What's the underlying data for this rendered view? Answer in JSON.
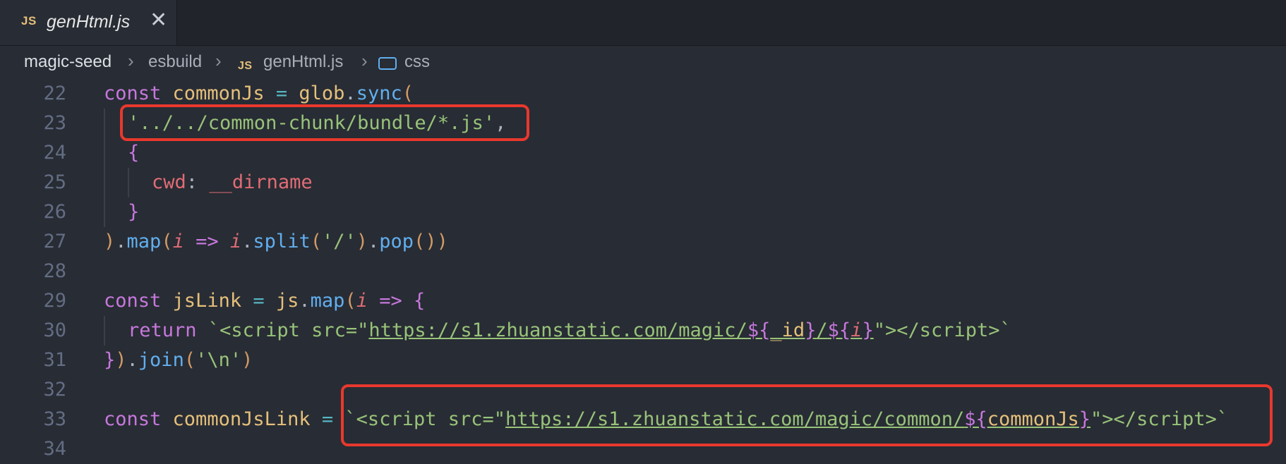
{
  "tab": {
    "badge": "JS",
    "title": "genHtml.js",
    "close": "✕"
  },
  "breadcrumb": {
    "items": [
      {
        "label": "magic-seed"
      },
      {
        "label": "esbuild"
      },
      {
        "label": "genHtml.js",
        "badge": "JS"
      },
      {
        "label": "css",
        "icon": "symbol-variable-icon"
      }
    ],
    "separator": "›"
  },
  "editor": {
    "line_numbers": [
      "22",
      "23",
      "24",
      "25",
      "26",
      "27",
      "28",
      "29",
      "30",
      "31",
      "32",
      "33",
      "34"
    ],
    "highlight_color": "#e8382e"
  }
}
